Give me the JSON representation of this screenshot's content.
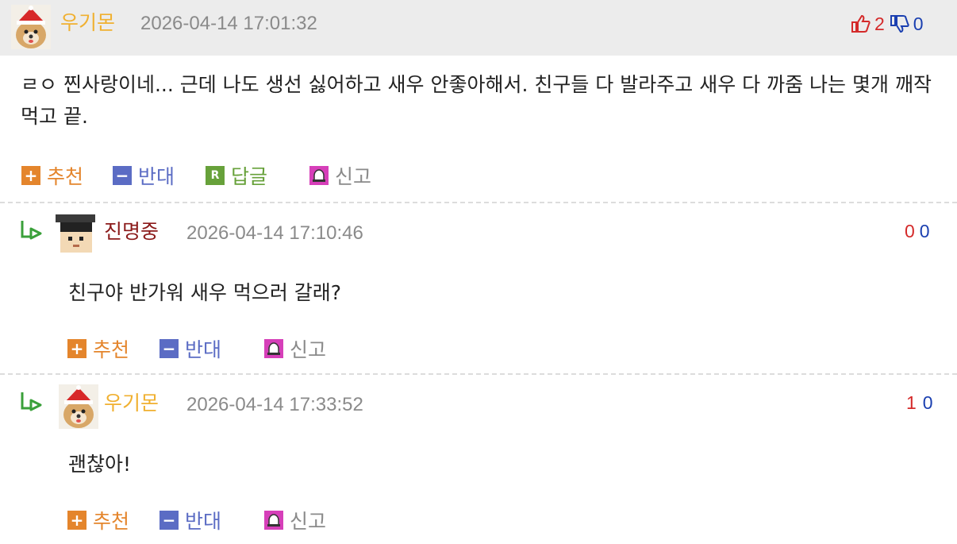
{
  "comments": [
    {
      "nickname": "우기몬",
      "nick_color": "#f0b030",
      "date": "2026-04-14 17:01:32",
      "up": "2",
      "down": "0",
      "text": "ㄹㅇ 찐사랑이네... 근데 나도 생선 싫어하고 새우 안좋아해서. 친구들 다 발라주고 새우 다 까줌 나는 몇개 깨작 먹고 끝.",
      "actions": {
        "recommend": "추천",
        "oppose": "반대",
        "reply": "답글",
        "report": "신고"
      }
    },
    {
      "nickname": "진명중",
      "nick_color": "#8b1a1a",
      "date": "2026-04-14 17:10:46",
      "up": "0",
      "down": "0",
      "text": "친구야 반가워 새우 먹으러 갈래?",
      "actions": {
        "recommend": "추천",
        "oppose": "반대",
        "report": "신고"
      }
    },
    {
      "nickname": "우기몬",
      "nick_color": "#f0b030",
      "date": "2026-04-14 17:33:52",
      "up": "1",
      "down": "0",
      "text": "괜찮아!",
      "actions": {
        "recommend": "추천",
        "oppose": "반대",
        "report": "신고"
      }
    }
  ],
  "icons": {
    "thumb_up": "thumbs-up-icon",
    "thumb_down": "thumbs-down-icon",
    "reply_arrow": "reply-arrow-icon",
    "plus": "plus-icon",
    "minus": "minus-icon",
    "reply": "reply-icon",
    "report": "siren-icon"
  },
  "colors": {
    "up": "#d42a2a",
    "down": "#1a3fb0",
    "recommend": "#e4852c",
    "oppose": "#5b6cc4",
    "reply": "#67a13a",
    "report": "#8a8a8a"
  }
}
